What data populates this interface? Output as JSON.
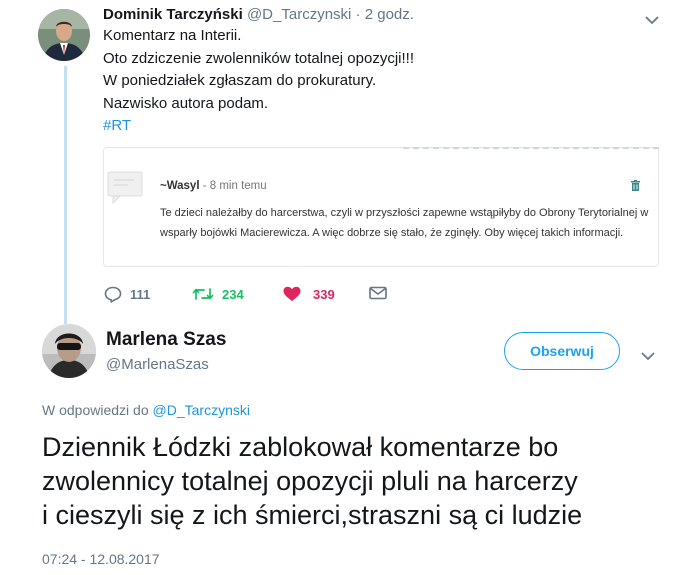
{
  "tweet": {
    "name": "Dominik Tarczyński",
    "handle": "@D_Tarczynski",
    "separator": "·",
    "time": "2 godz.",
    "lines": [
      "Komentarz na Interii.",
      "Oto zdziczenie zwolenników totalnej opozycji!!!",
      "W poniedziałek zgłaszam do prokuratury.",
      "Nazwisko autora podam."
    ],
    "hashtag": "#RT",
    "quote": {
      "author": "~Wasyl",
      "separator": " - ",
      "time": "8 min temu",
      "text": "Te dzieci należałby do harcerstwa, czyli w przyszłości zapewne wstąpiłyby do Obrony Terytorialnej w wsparły bojówki Macierewicza. A więc dobrze się stało, że zginęły. Oby więcej takich informacji."
    },
    "actions": {
      "replies": "111",
      "retweets": "234",
      "likes": "339"
    }
  },
  "reply": {
    "name": "Marlena Szas",
    "handle": "@MarlenaSzas",
    "follow_label": "Obserwuj",
    "reply_prefix": "W odpowiedzi do",
    "reply_mention": "@D_Tarczynski",
    "lines": [
      "Dziennik Łódzki zablokował komentarze bo",
      "zwolennicy totalnej opozycji pluli na harcerzy",
      "i cieszyli się z ich śmierci,straszni są ci ludzie"
    ],
    "timestamp": "07:24 - 12.08.2017"
  },
  "colors": {
    "accent": "#1da1f2",
    "link": "#1b95e0",
    "retweet": "#17bf63",
    "like": "#e0245e",
    "muted": "#657786",
    "thread_line": "#c4e1f3"
  },
  "icons": [
    "reply-icon",
    "retweet-icon",
    "heart-icon",
    "direct-message-icon",
    "chevron-down-icon",
    "trash-icon",
    "comment-placeholder-icon"
  ]
}
